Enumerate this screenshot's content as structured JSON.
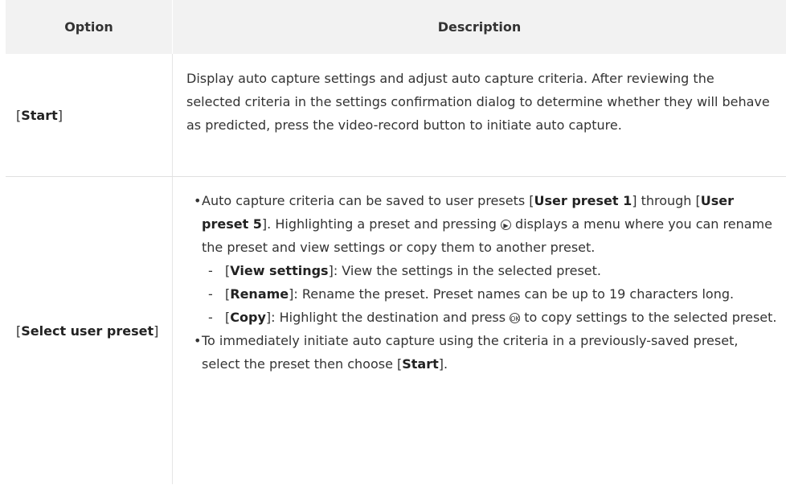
{
  "header": {
    "option": "Option",
    "description": "Description"
  },
  "rows": [
    {
      "option": "Start",
      "description": "Display auto capture settings and adjust auto capture criteria. After reviewing the selected criteria in the settings confirmation dialog to determine whether they will behave as predicted, press the video-record button to initiate auto capture."
    },
    {
      "option": "Select user preset",
      "bullet1": {
        "t1": "Auto capture criteria can be saved to user presets [",
        "b1": "User preset 1",
        "t2": "] through [",
        "b2": "User preset 5",
        "t3": "]. Highlighting a preset and pressing ",
        "icon": "multi-selector-right-icon",
        "t4": " displays a menu where you can rename the preset and view settings or copy them to another preset."
      },
      "subitems": [
        {
          "label": "View settings",
          "text": ": View the settings in the selected preset."
        },
        {
          "label": "Rename",
          "text": ": Rename the preset. Preset names can be up to 19 characters long."
        },
        {
          "label": "Copy",
          "t1": ": Highlight the destination and press ",
          "icon": "ok-button-icon",
          "t2": " to copy settings to the selected preset."
        }
      ],
      "bullet2": {
        "t1": "To immediately initiate auto capture using the criteria in a previously-saved preset, select the preset then choose [",
        "b1": "Start",
        "t2": "]."
      }
    }
  ]
}
